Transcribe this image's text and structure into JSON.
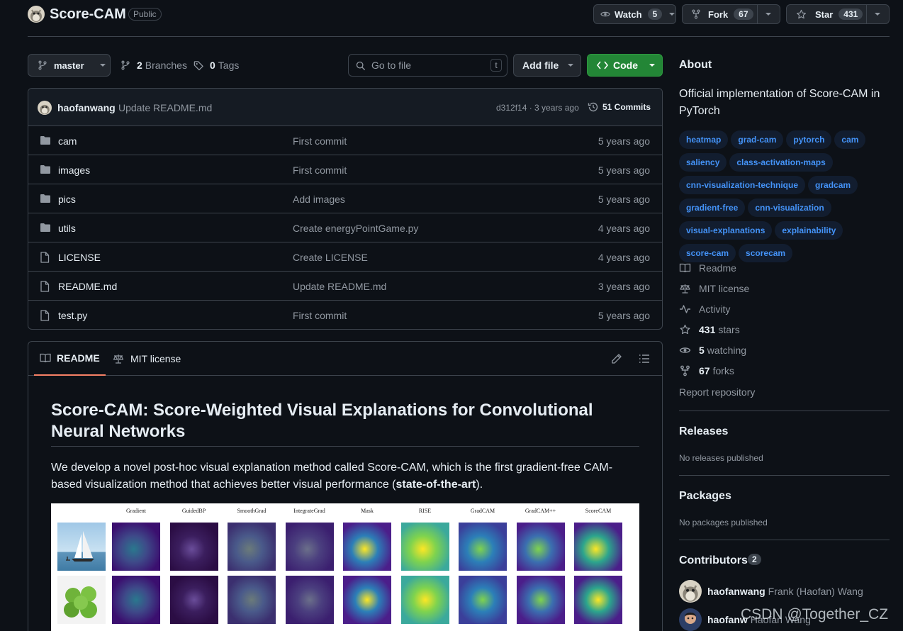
{
  "repo": {
    "name": "Score-CAM",
    "visibility": "Public"
  },
  "actions": {
    "watch": {
      "label": "Watch",
      "count": "5"
    },
    "fork": {
      "label": "Fork",
      "count": "67"
    },
    "star": {
      "label": "Star",
      "count": "431"
    }
  },
  "toolbar": {
    "branch": "master",
    "branches_count": "2",
    "branches_label": "Branches",
    "tags_count": "0",
    "tags_label": "Tags",
    "search_placeholder": "Go to file",
    "search_key": "t",
    "add_file": "Add file",
    "code": "Code"
  },
  "latest_commit": {
    "author": "haofanwang",
    "message": "Update README.md",
    "hash_time": "d312f14 · 3 years ago",
    "commits": "51 Commits"
  },
  "files": [
    {
      "type": "folder",
      "name": "cam",
      "message": "First commit",
      "age": "5 years ago"
    },
    {
      "type": "folder",
      "name": "images",
      "message": "First commit",
      "age": "5 years ago"
    },
    {
      "type": "folder",
      "name": "pics",
      "message": "Add images",
      "age": "5 years ago"
    },
    {
      "type": "folder",
      "name": "utils",
      "message": "Create energyPointGame.py",
      "age": "4 years ago"
    },
    {
      "type": "file",
      "name": "LICENSE",
      "message": "Create LICENSE",
      "age": "4 years ago"
    },
    {
      "type": "file",
      "name": "README.md",
      "message": "Update README.md",
      "age": "3 years ago"
    },
    {
      "type": "file",
      "name": "test.py",
      "message": "First commit",
      "age": "5 years ago"
    }
  ],
  "readme": {
    "tab_readme": "README",
    "tab_license": "MIT license",
    "title": "Score-CAM: Score-Weighted Visual Explanations for Convolutional Neural Networks",
    "para_text": "We develop a novel post-hoc visual explanation method called Score-CAM, which is the first gradient-free CAM-based visualization method that achieves better visual performance (",
    "para_bold": "state-of-the-art",
    "para_end": ").",
    "figure_columns": [
      "Gradient",
      "GuidedBP",
      "SmoothGrad",
      "IntegrateGrad",
      "Mask",
      "RISE",
      "GradCAM",
      "GradCAM++",
      "ScoreCAM"
    ]
  },
  "about": {
    "heading": "About",
    "description": "Official implementation of Score-CAM in PyTorch",
    "topics": [
      "heatmap",
      "grad-cam",
      "pytorch",
      "cam",
      "saliency",
      "class-activation-maps",
      "cnn-visualization-technique",
      "gradcam",
      "gradient-free",
      "cnn-visualization",
      "visual-explanations",
      "explainability",
      "score-cam",
      "scorecam"
    ],
    "readme": "Readme",
    "license": "MIT license",
    "activity": "Activity",
    "stars_count": "431",
    "stars_label": "stars",
    "watching_count": "5",
    "watching_label": "watching",
    "forks_count": "67",
    "forks_label": "forks",
    "report": "Report repository"
  },
  "releases": {
    "heading": "Releases",
    "text": "No releases published"
  },
  "packages": {
    "heading": "Packages",
    "text": "No packages published"
  },
  "contributors": {
    "heading": "Contributors",
    "count": "2",
    "list": [
      {
        "login": "haofanwang",
        "name": "Frank (Haofan) Wang"
      },
      {
        "login": "haofanw",
        "name": "Haofan Wang"
      }
    ]
  },
  "watermark": "CSDN @Together_CZ",
  "colors": {
    "bg": "#0d1117",
    "accent": "#4493f8",
    "code_button": "#238636",
    "border": "#3d444d"
  }
}
